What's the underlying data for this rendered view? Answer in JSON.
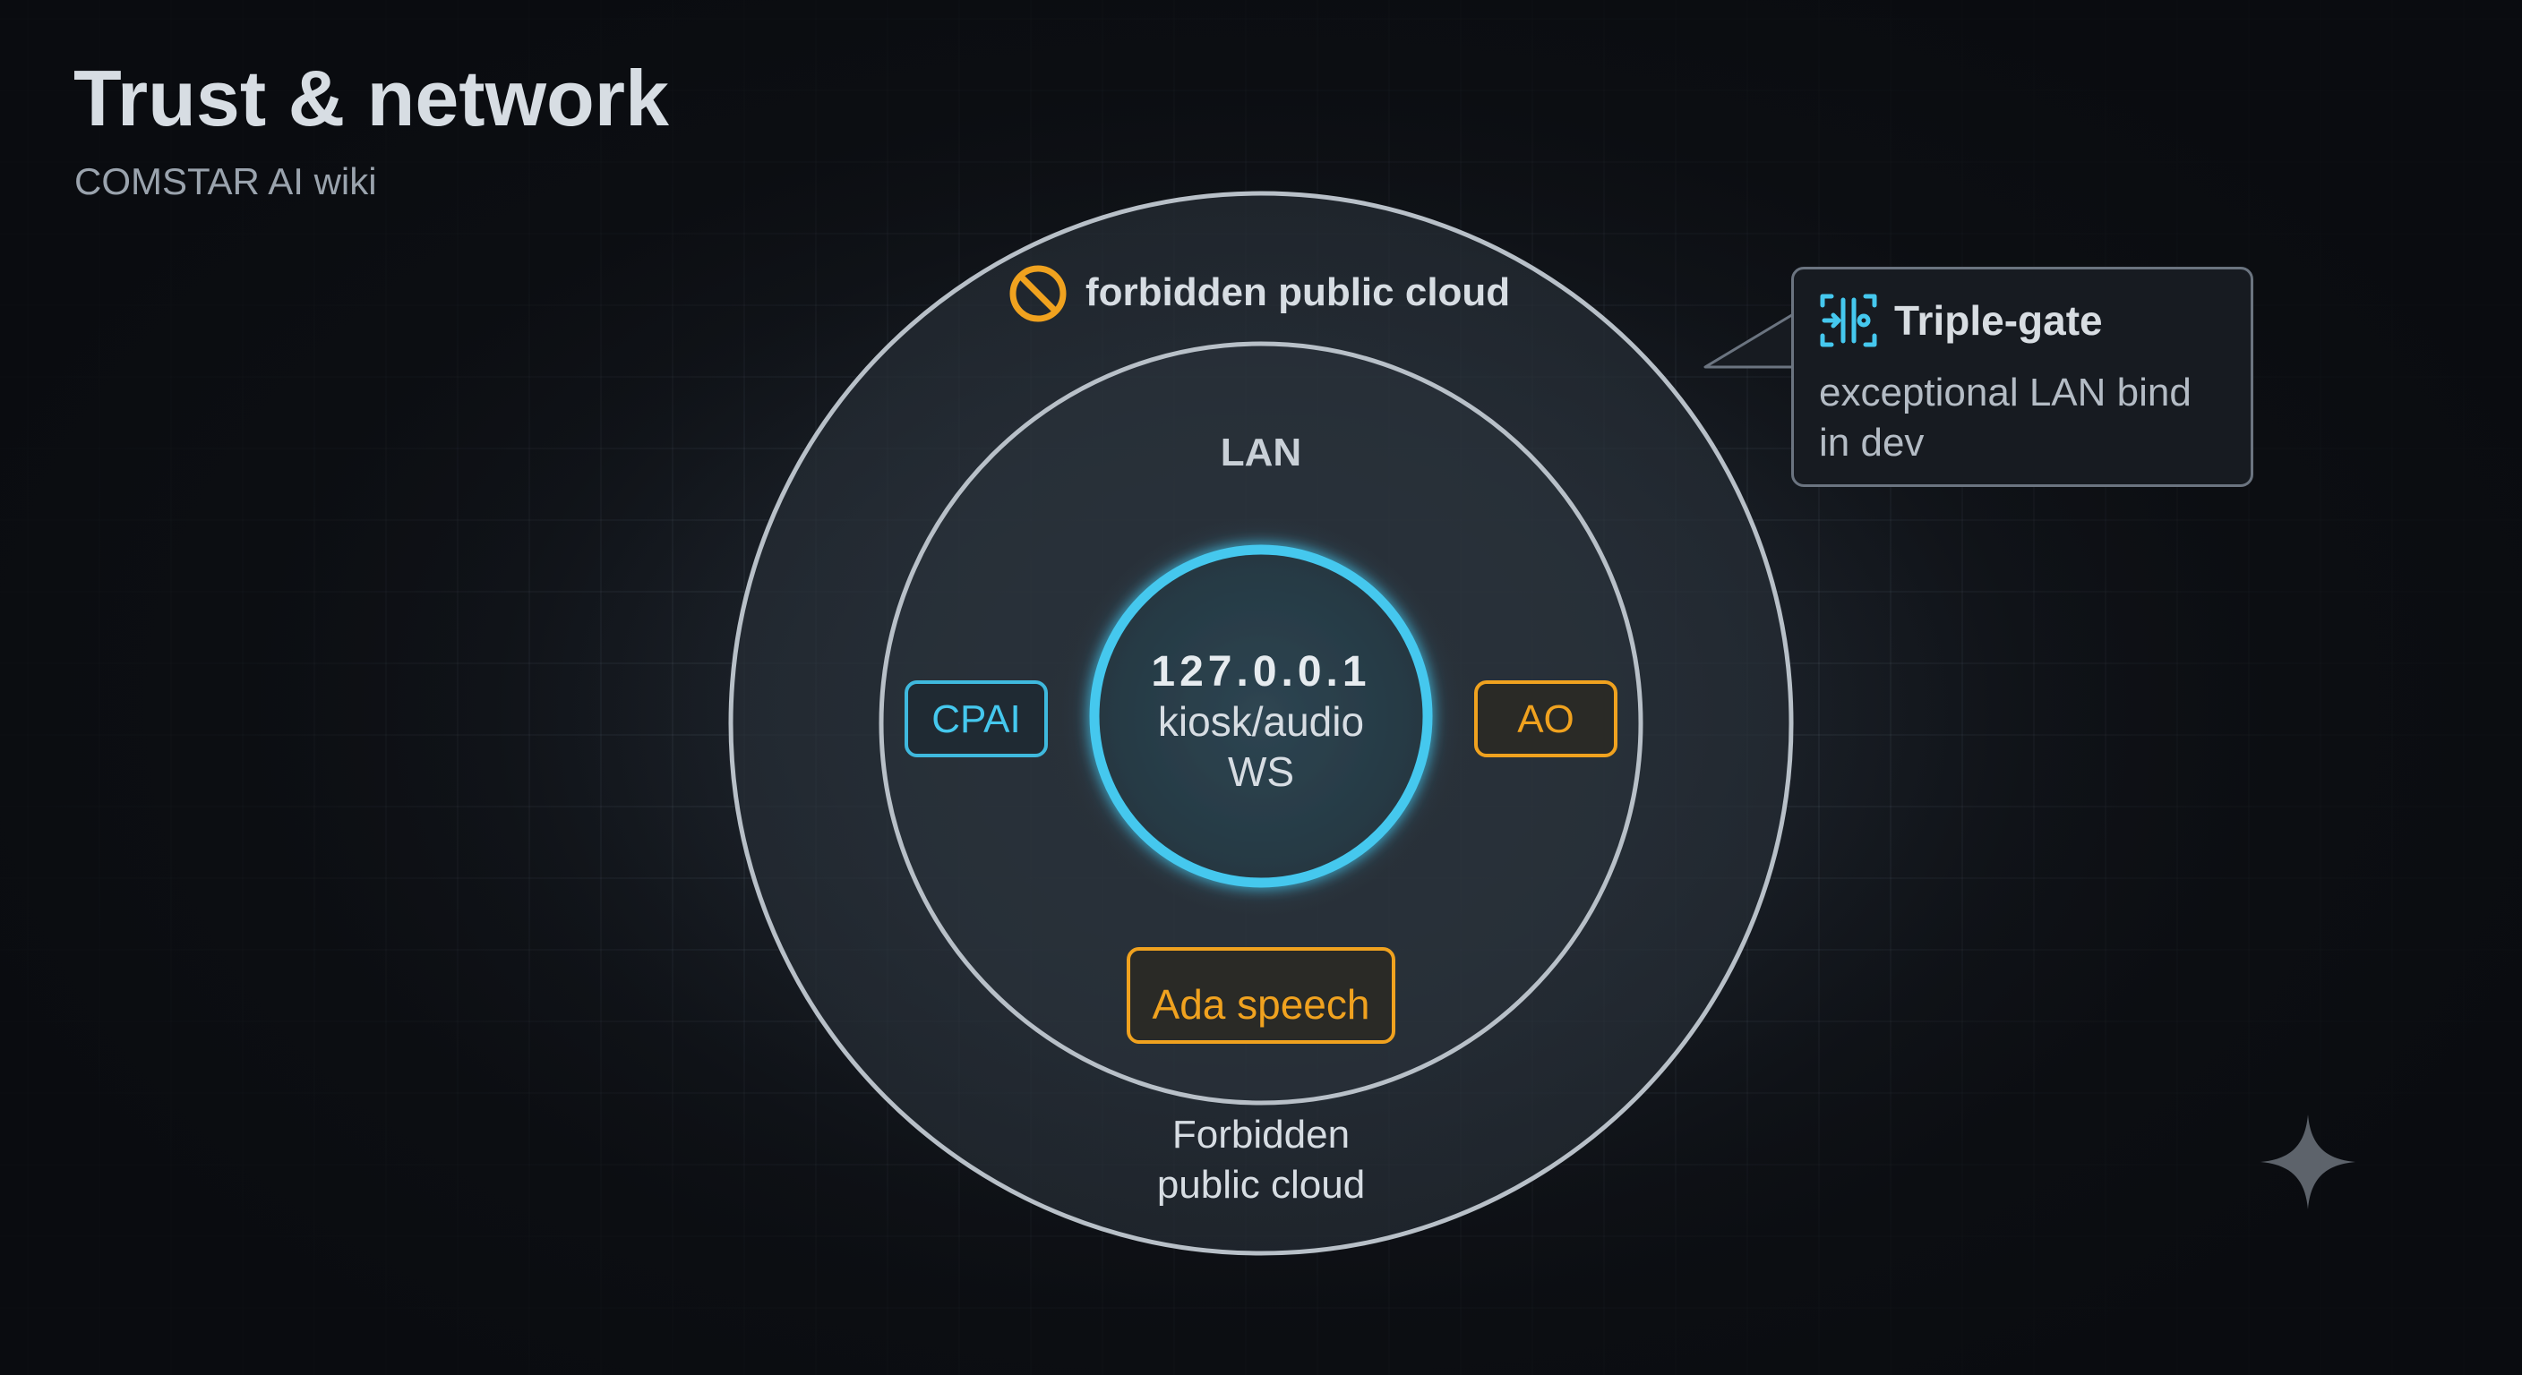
{
  "header": {
    "title": "Trust & network",
    "subtitle": "COMSTAR AI wiki"
  },
  "diagram": {
    "outer_ring": {
      "top_label": "forbidden public cloud",
      "bottom_label_line1": "Forbidden",
      "bottom_label_line2": "public cloud"
    },
    "middle_ring": {
      "label": "LAN"
    },
    "core": {
      "line1": "127.0.0.1",
      "line2": "kiosk/audio",
      "line3": "WS"
    },
    "nodes": [
      {
        "label": "CPAI",
        "color": "#3fb9de"
      },
      {
        "label": "AO",
        "color": "#f0a21f"
      },
      {
        "label": "Ada speech",
        "color": "#f0a21f"
      }
    ],
    "callout": {
      "title": "Triple-gate",
      "body_line1": "exceptional LAN bind",
      "body_line2": "in dev"
    }
  },
  "colors": {
    "cyan": "#45c8ee",
    "amber": "#f0a21f",
    "ring": "#b3bcc5",
    "text": "#d7dde3"
  },
  "icons": [
    "forbidden-icon",
    "triple-gate-icon",
    "sparkle-icon"
  ]
}
